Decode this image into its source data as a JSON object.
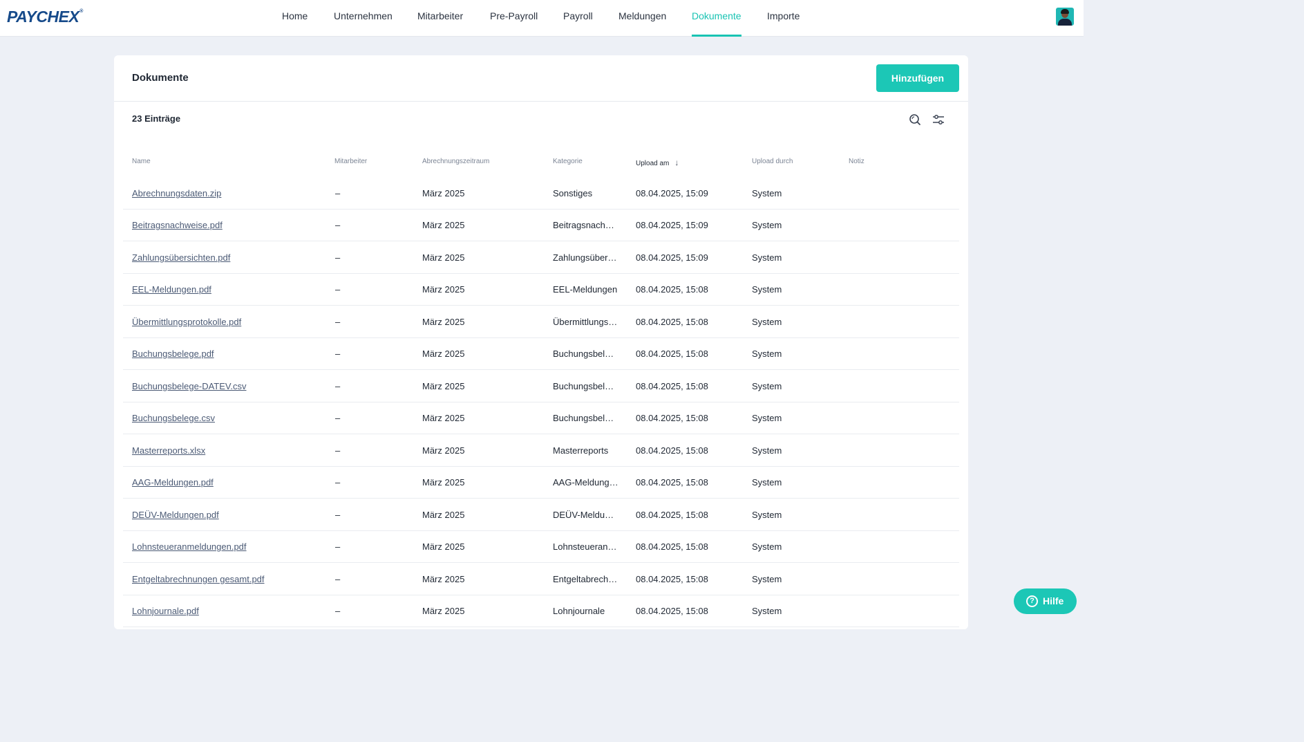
{
  "brand": {
    "name": "PAYCHEX",
    "mark": "®"
  },
  "nav": {
    "items": [
      {
        "label": "Home"
      },
      {
        "label": "Unternehmen"
      },
      {
        "label": "Mitarbeiter"
      },
      {
        "label": "Pre-Payroll"
      },
      {
        "label": "Payroll"
      },
      {
        "label": "Meldungen"
      },
      {
        "label": "Dokumente",
        "active": true
      },
      {
        "label": "Importe"
      }
    ]
  },
  "page": {
    "title": "Dokumente",
    "add_button": "Hinzufügen",
    "entry_count": "23 Einträge",
    "icons": [
      "search-icon",
      "filter-sliders-icon"
    ]
  },
  "table": {
    "columns": [
      "Name",
      "Mitarbeiter",
      "Abrechnungszeitraum",
      "Kategorie",
      "Upload am",
      "Upload durch",
      "Notiz"
    ],
    "sorted_column": "Upload am",
    "sort_direction": "desc",
    "rows": [
      {
        "name": "Abrechnungsdaten.zip",
        "employee": "–",
        "period": "März 2025",
        "category": "Sonstiges",
        "uploaded": "08.04.2025, 15:09",
        "by": "System",
        "note": ""
      },
      {
        "name": "Beitragsnachweise.pdf",
        "employee": "–",
        "period": "März 2025",
        "category": "Beitragsnach…",
        "uploaded": "08.04.2025, 15:09",
        "by": "System",
        "note": ""
      },
      {
        "name": "Zahlungsübersichten.pdf",
        "employee": "–",
        "period": "März 2025",
        "category": "Zahlungsüber…",
        "uploaded": "08.04.2025, 15:09",
        "by": "System",
        "note": ""
      },
      {
        "name": "EEL-Meldungen.pdf",
        "employee": "–",
        "period": "März 2025",
        "category": "EEL-Meldungen",
        "uploaded": "08.04.2025, 15:08",
        "by": "System",
        "note": ""
      },
      {
        "name": "Übermittlungsprotokolle.pdf",
        "employee": "–",
        "period": "März 2025",
        "category": "Übermittlungs…",
        "uploaded": "08.04.2025, 15:08",
        "by": "System",
        "note": ""
      },
      {
        "name": "Buchungsbelege.pdf",
        "employee": "–",
        "period": "März 2025",
        "category": "Buchungsbele…",
        "uploaded": "08.04.2025, 15:08",
        "by": "System",
        "note": ""
      },
      {
        "name": "Buchungsbelege-DATEV.csv",
        "employee": "–",
        "period": "März 2025",
        "category": "Buchungsbele…",
        "uploaded": "08.04.2025, 15:08",
        "by": "System",
        "note": ""
      },
      {
        "name": "Buchungsbelege.csv",
        "employee": "–",
        "period": "März 2025",
        "category": "Buchungsbele…",
        "uploaded": "08.04.2025, 15:08",
        "by": "System",
        "note": ""
      },
      {
        "name": "Masterreports.xlsx",
        "employee": "–",
        "period": "März 2025",
        "category": "Masterreports",
        "uploaded": "08.04.2025, 15:08",
        "by": "System",
        "note": ""
      },
      {
        "name": "AAG-Meldungen.pdf",
        "employee": "–",
        "period": "März 2025",
        "category": "AAG-Meldung…",
        "uploaded": "08.04.2025, 15:08",
        "by": "System",
        "note": ""
      },
      {
        "name": "DEÜV-Meldungen.pdf",
        "employee": "–",
        "period": "März 2025",
        "category": "DEÜV-Meldun…",
        "uploaded": "08.04.2025, 15:08",
        "by": "System",
        "note": ""
      },
      {
        "name": "Lohnsteueranmeldungen.pdf",
        "employee": "–",
        "period": "März 2025",
        "category": "Lohnsteueran…",
        "uploaded": "08.04.2025, 15:08",
        "by": "System",
        "note": ""
      },
      {
        "name": "Entgeltabrechnungen gesamt.pdf",
        "employee": "–",
        "period": "März 2025",
        "category": "Entgeltabrech…",
        "uploaded": "08.04.2025, 15:08",
        "by": "System",
        "note": ""
      },
      {
        "name": "Lohnjournale.pdf",
        "employee": "–",
        "period": "März 2025",
        "category": "Lohnjournale",
        "uploaded": "08.04.2025, 15:08",
        "by": "System",
        "note": ""
      }
    ]
  },
  "help": {
    "label": "Hilfe"
  },
  "colors": {
    "accent": "#1cc7b6",
    "brand": "#164a8a",
    "background": "#edf0f6"
  }
}
